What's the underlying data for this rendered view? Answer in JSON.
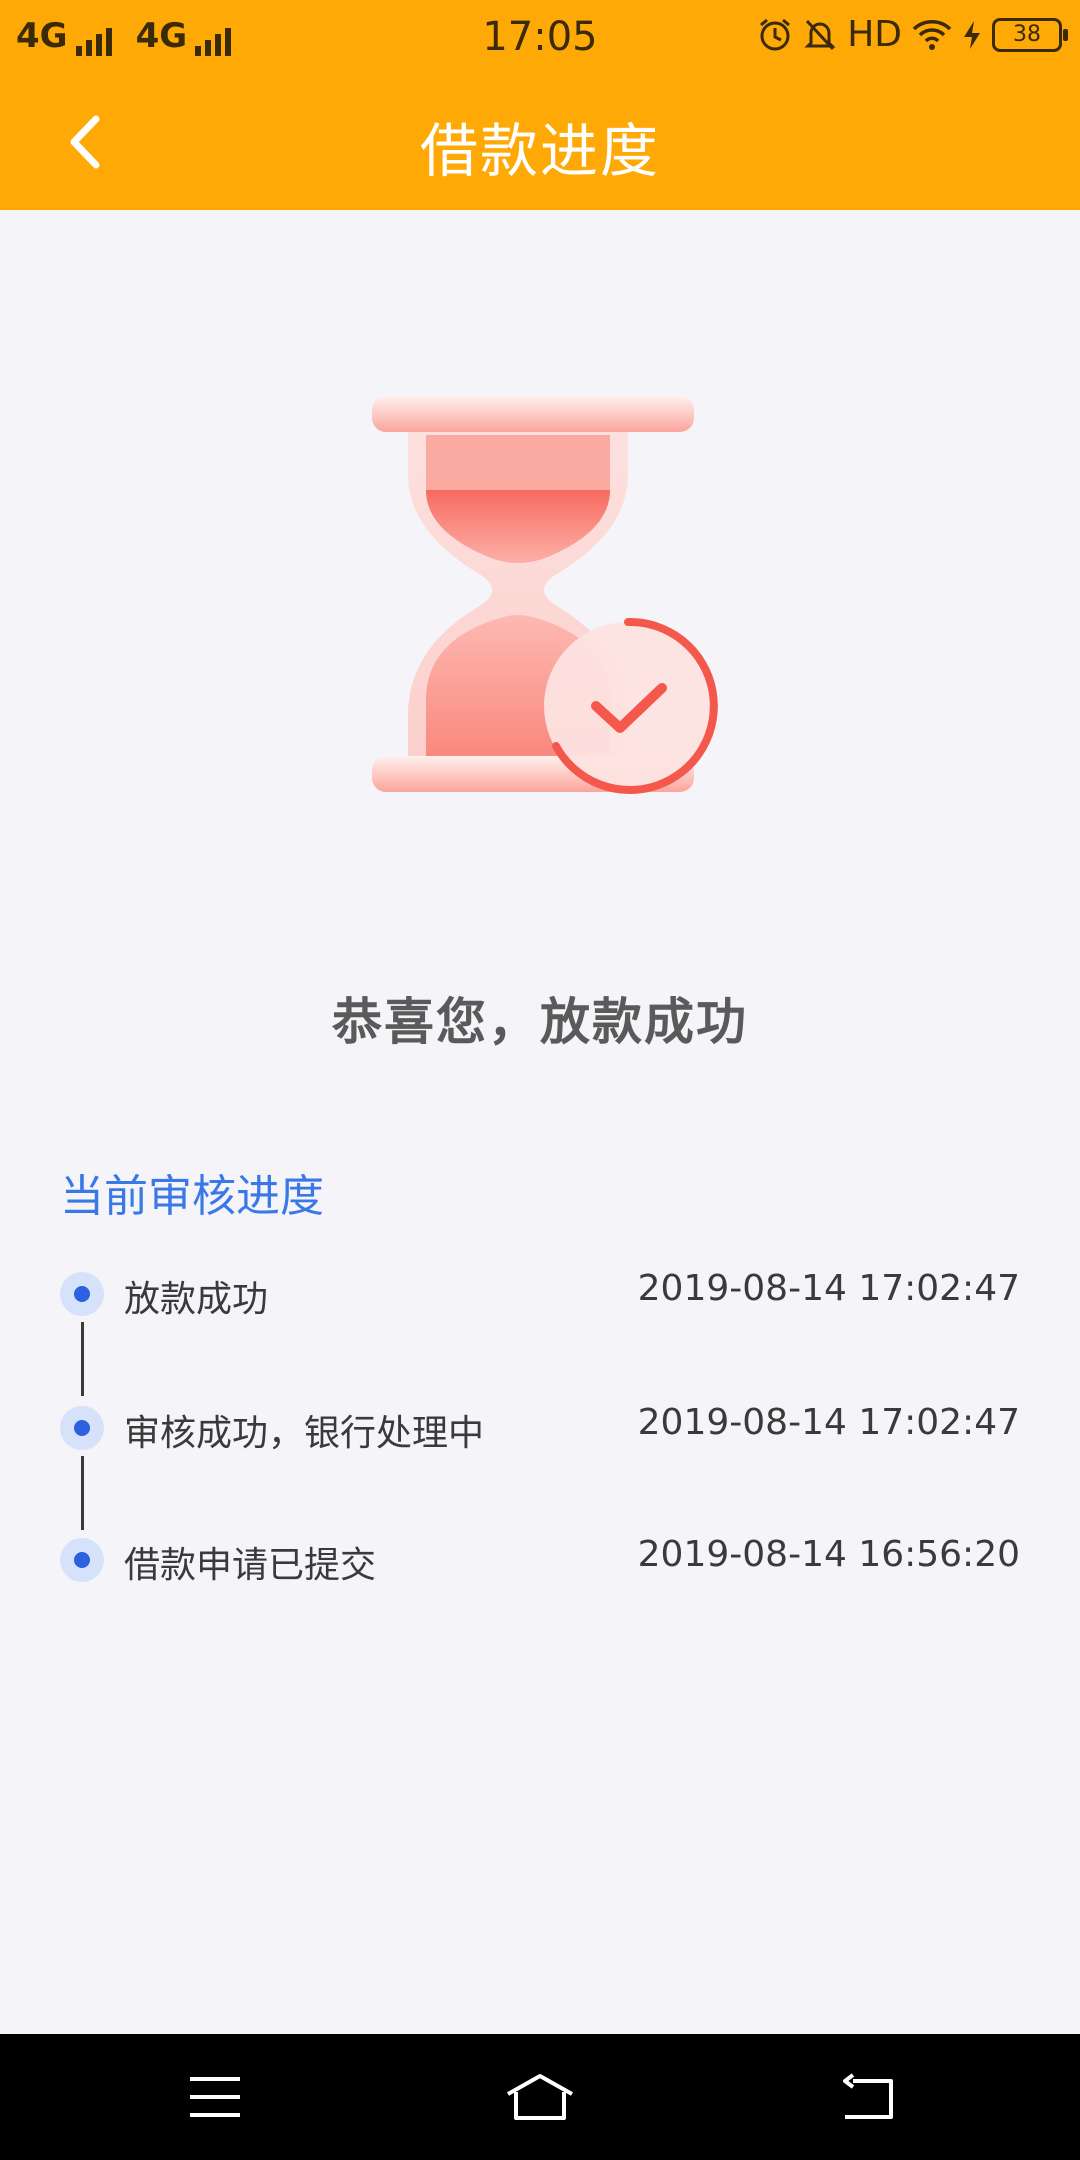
{
  "status_bar": {
    "network1": "4G",
    "network2": "4G",
    "time": "17:05",
    "hd_label": "HD",
    "battery": "38"
  },
  "header": {
    "title": "借款进度"
  },
  "result": {
    "message": "恭喜您，放款成功"
  },
  "progress": {
    "section_title": "当前审核进度",
    "steps": [
      {
        "label": "放款成功",
        "time": "2019-08-14 17:02:47"
      },
      {
        "label": "审核成功，银行处理中",
        "time": "2019-08-14 17:02:47"
      },
      {
        "label": "借款申请已提交",
        "time": "2019-08-14 16:56:20"
      }
    ]
  },
  "colors": {
    "header_bg": "#fea905",
    "accent_blue": "#3b78e7",
    "dot_blue": "#2c62e0",
    "illustration_red": "#f4584c"
  },
  "icons": [
    "back-chevron-icon",
    "alarm-icon",
    "mute-bell-icon",
    "wifi-icon",
    "charging-icon",
    "battery-icon",
    "hourglass-illustration",
    "check-circle-icon",
    "menu-icon",
    "home-icon",
    "back-icon"
  ]
}
